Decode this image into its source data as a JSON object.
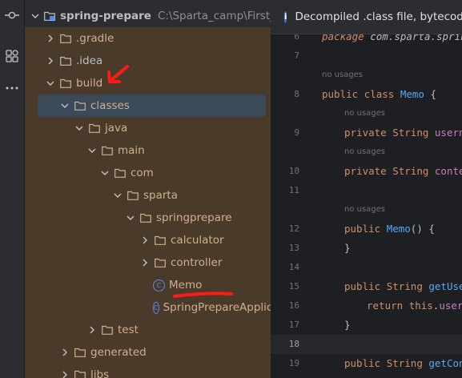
{
  "tree": {
    "root_label": "spring-prepare",
    "root_path": "C:\\Sparta_camp\\First_Sprin",
    "items": [
      {
        "label": ".gradle",
        "kind": "folder",
        "expanded": false
      },
      {
        "label": ".idea",
        "kind": "folder",
        "expanded": false
      },
      {
        "label": "build",
        "kind": "folder",
        "expanded": true
      },
      {
        "label": "classes",
        "kind": "folder",
        "expanded": true
      },
      {
        "label": "java",
        "kind": "folder",
        "expanded": true
      },
      {
        "label": "main",
        "kind": "folder",
        "expanded": true
      },
      {
        "label": "com",
        "kind": "folder",
        "expanded": true
      },
      {
        "label": "sparta",
        "kind": "folder",
        "expanded": true
      },
      {
        "label": "springprepare",
        "kind": "folder",
        "expanded": true
      },
      {
        "label": "calculator",
        "kind": "folder",
        "expanded": false
      },
      {
        "label": "controller",
        "kind": "folder",
        "expanded": false
      },
      {
        "label": "Memo",
        "kind": "class"
      },
      {
        "label": "SpringPrepareApplica",
        "kind": "class"
      },
      {
        "label": "test",
        "kind": "folder",
        "expanded": false
      },
      {
        "label": "generated",
        "kind": "folder",
        "expanded": false
      },
      {
        "label": "libs",
        "kind": "folder",
        "expanded": false
      }
    ]
  },
  "banner": {
    "text": "Decompiled .class file, bytecode"
  },
  "editor": {
    "hint": "no usages",
    "lines": [
      {
        "num": "6",
        "code": "package com.sparta.spring"
      },
      {
        "num": "7",
        "code": ""
      },
      {
        "num": "8",
        "code": "public class Memo {"
      },
      {
        "num": "9",
        "code": "private String userna"
      },
      {
        "num": "10",
        "code": "private String conten"
      },
      {
        "num": "11",
        "code": ""
      },
      {
        "num": "12",
        "code": "public Memo() {"
      },
      {
        "num": "13",
        "code": "}"
      },
      {
        "num": "14",
        "code": ""
      },
      {
        "num": "15",
        "code": "public String getUser"
      },
      {
        "num": "16",
        "code": "return this.userna"
      },
      {
        "num": "17",
        "code": "}"
      },
      {
        "num": "18",
        "code": ""
      },
      {
        "num": "19",
        "code": "public String getCont"
      }
    ]
  },
  "colors": {
    "excluded_bg": "#4a3a2a",
    "selection": "#2e436e",
    "accent": "#3574f0",
    "annotation": "#ff1a1a"
  }
}
